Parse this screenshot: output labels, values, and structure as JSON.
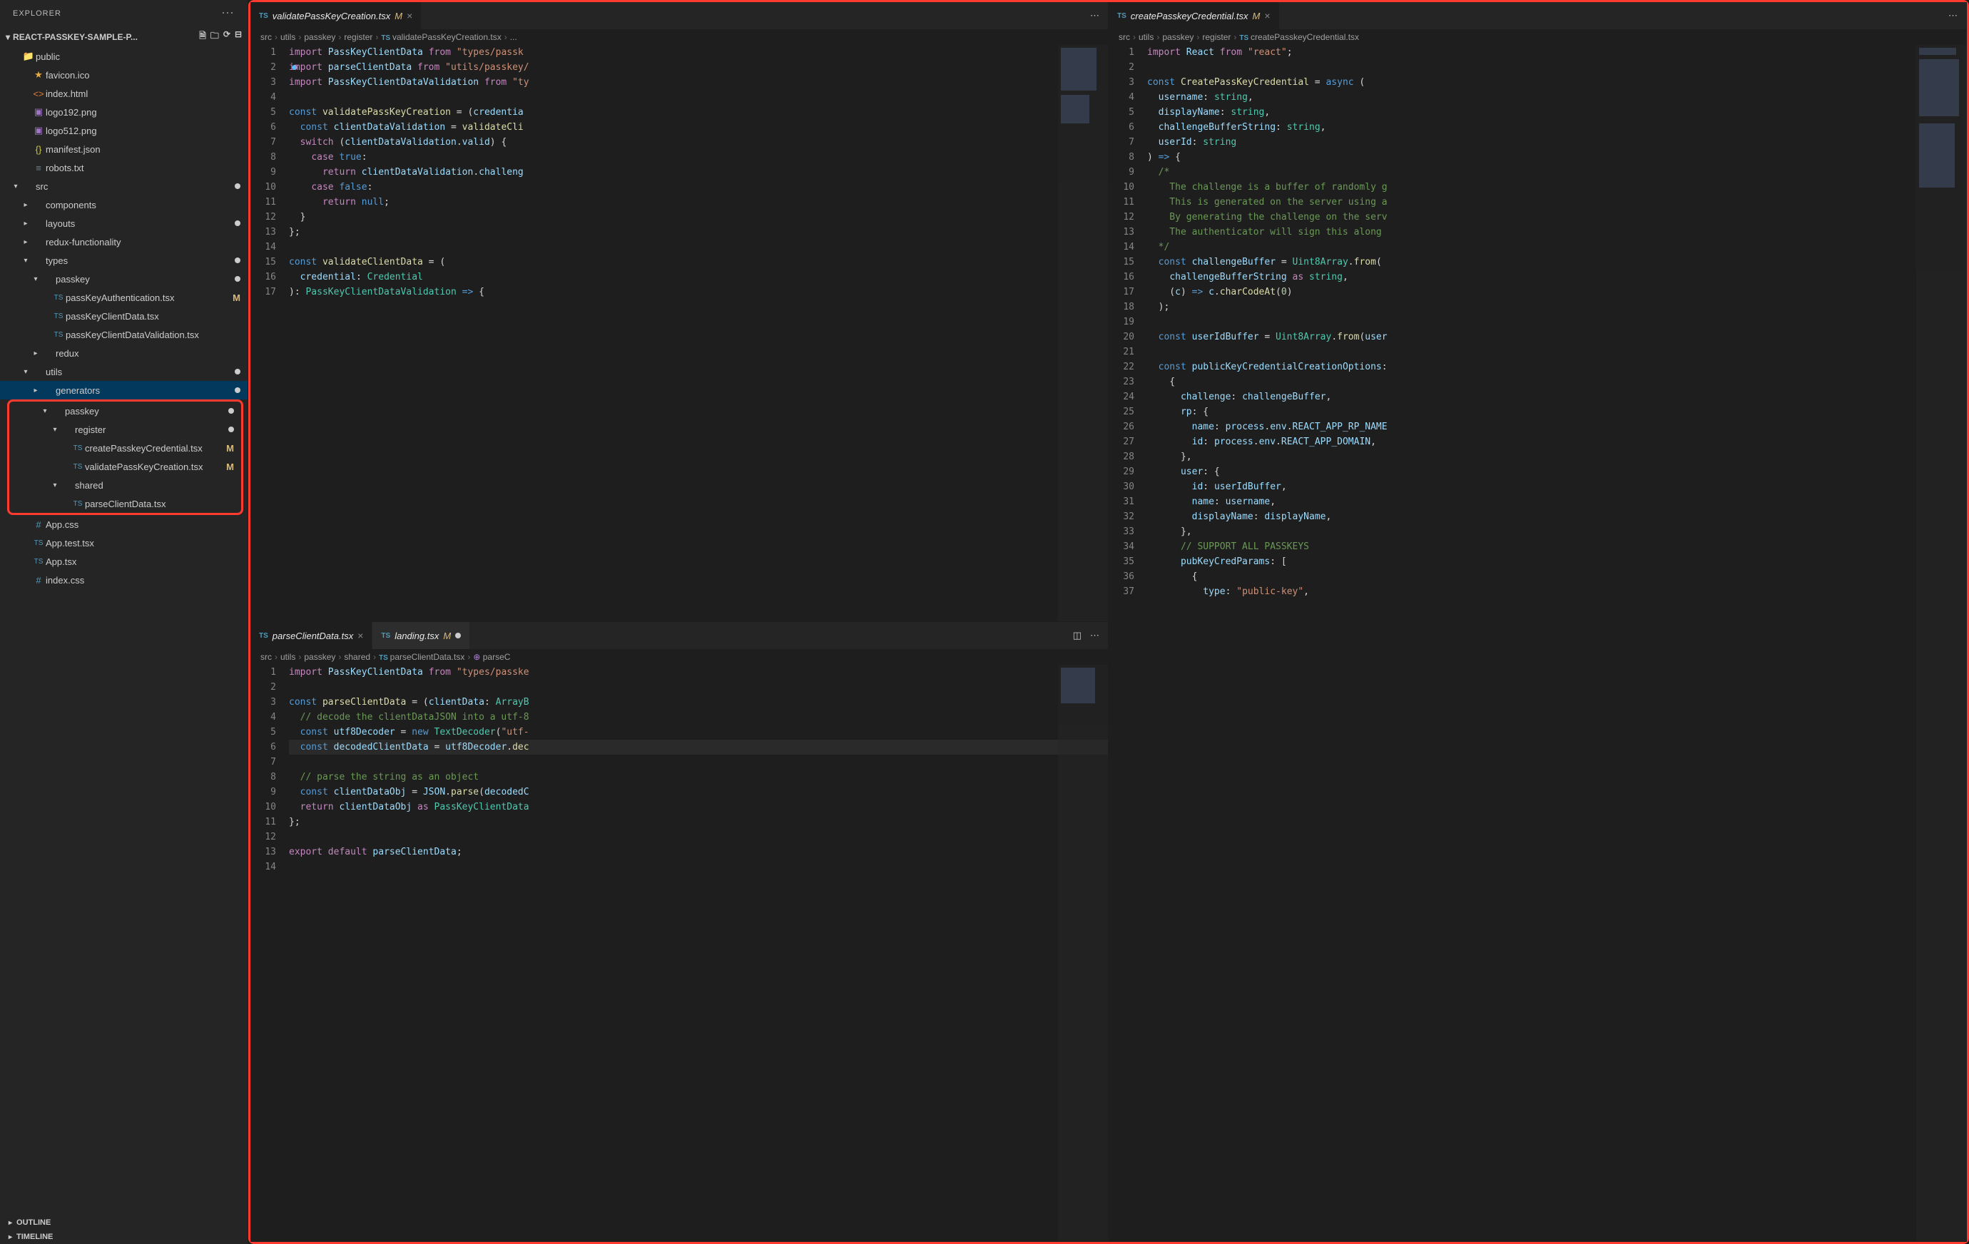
{
  "sidebar": {
    "title": "EXPLORER",
    "project": "REACT-PASSKEY-SAMPLE-P...",
    "outline": "OUTLINE",
    "timeline": "TIMELINE"
  },
  "tree": [
    {
      "depth": 1,
      "twisty": "",
      "icon": "📁",
      "label": "public",
      "color": "#c09553",
      "dot": false
    },
    {
      "depth": 2,
      "twisty": "",
      "icon": "★",
      "iconColor": "#e8ab3f",
      "label": "favicon.ico"
    },
    {
      "depth": 2,
      "twisty": "",
      "icon": "<>",
      "iconColor": "#e37933",
      "label": "index.html"
    },
    {
      "depth": 2,
      "twisty": "",
      "icon": "▣",
      "iconColor": "#a074c4",
      "label": "logo192.png"
    },
    {
      "depth": 2,
      "twisty": "",
      "icon": "▣",
      "iconColor": "#a074c4",
      "label": "logo512.png"
    },
    {
      "depth": 2,
      "twisty": "",
      "icon": "{}",
      "iconColor": "#cbcb41",
      "label": "manifest.json"
    },
    {
      "depth": 2,
      "twisty": "",
      "icon": "≡",
      "iconColor": "#6d8086",
      "label": "robots.txt"
    },
    {
      "depth": 1,
      "twisty": "▾",
      "icon": "",
      "label": "src",
      "dot": true
    },
    {
      "depth": 2,
      "twisty": "▸",
      "icon": "",
      "label": "components"
    },
    {
      "depth": 2,
      "twisty": "▸",
      "icon": "",
      "label": "layouts",
      "dot": true
    },
    {
      "depth": 2,
      "twisty": "▸",
      "icon": "",
      "label": "redux-functionality"
    },
    {
      "depth": 2,
      "twisty": "▾",
      "icon": "",
      "label": "types",
      "dot": true
    },
    {
      "depth": 3,
      "twisty": "▾",
      "icon": "",
      "label": "passkey",
      "dot": true
    },
    {
      "depth": 4,
      "twisty": "",
      "icon": "TS",
      "iconColor": "#519aba",
      "label": "passKeyAuthentication.tsx",
      "badge": "M"
    },
    {
      "depth": 4,
      "twisty": "",
      "icon": "TS",
      "iconColor": "#519aba",
      "label": "passKeyClientData.tsx"
    },
    {
      "depth": 4,
      "twisty": "",
      "icon": "TS",
      "iconColor": "#519aba",
      "label": "passKeyClientDataValidation.tsx"
    },
    {
      "depth": 3,
      "twisty": "▸",
      "icon": "",
      "label": "redux"
    },
    {
      "depth": 2,
      "twisty": "▾",
      "icon": "",
      "label": "utils",
      "dot": true
    },
    {
      "depth": 3,
      "twisty": "▸",
      "icon": "",
      "label": "generators",
      "dot": true,
      "selected": true
    },
    {
      "depth": 3,
      "twisty": "▾",
      "icon": "",
      "label": "passkey",
      "dot": true,
      "redstart": true
    },
    {
      "depth": 4,
      "twisty": "▾",
      "icon": "",
      "label": "register",
      "dot": true
    },
    {
      "depth": 5,
      "twisty": "",
      "icon": "TS",
      "iconColor": "#519aba",
      "label": "createPasskeyCredential.tsx",
      "badge": "M"
    },
    {
      "depth": 5,
      "twisty": "",
      "icon": "TS",
      "iconColor": "#519aba",
      "label": "validatePassKeyCreation.tsx",
      "badge": "M"
    },
    {
      "depth": 4,
      "twisty": "▾",
      "icon": "",
      "label": "shared"
    },
    {
      "depth": 5,
      "twisty": "",
      "icon": "TS",
      "iconColor": "#519aba",
      "label": "parseClientData.tsx",
      "redend": true
    },
    {
      "depth": 2,
      "twisty": "",
      "icon": "#",
      "iconColor": "#519aba",
      "label": "App.css"
    },
    {
      "depth": 2,
      "twisty": "",
      "icon": "TS",
      "iconColor": "#519aba",
      "label": "App.test.tsx"
    },
    {
      "depth": 2,
      "twisty": "",
      "icon": "TS",
      "iconColor": "#519aba",
      "label": "App.tsx"
    },
    {
      "depth": 2,
      "twisty": "",
      "icon": "#",
      "iconColor": "#519aba",
      "label": "index.css"
    }
  ],
  "tabs": {
    "p1": {
      "name": "validatePassKeyCreation.tsx",
      "mod": "M"
    },
    "p2a": {
      "name": "parseClientData.tsx"
    },
    "p2b": {
      "name": "landing.tsx",
      "mod": "M",
      "dirty": true
    },
    "p3": {
      "name": "createPasskeyCredential.tsx",
      "mod": "M"
    }
  },
  "crumbs": {
    "p1": [
      "src",
      "utils",
      "passkey",
      "register",
      "TS validatePassKeyCreation.tsx",
      "..."
    ],
    "p2": [
      "src",
      "utils",
      "passkey",
      "shared",
      "TS parseClientData.tsx",
      "[@] parseC"
    ],
    "p3": [
      "src",
      "utils",
      "passkey",
      "register",
      "TS createPasskeyCredential.tsx"
    ]
  },
  "code1": [
    {
      "n": 1,
      "h": "<span class='k-import'>import</span> <span class='k-var'>PassKeyClientData</span> <span class='k-import'>from</span> <span class='k-str'>\"types/passk</span>"
    },
    {
      "n": 2,
      "h": "<span class='k-import' style='background:radial-gradient(circle,#4fc1ff 30%,transparent 32%);'>im</span><span class='k-import'>port</span> <span class='k-var'>parseClientData</span> <span class='k-import'>from</span> <span class='k-str'>\"utils/passkey/</span>"
    },
    {
      "n": 3,
      "h": "<span class='k-import'>import</span> <span class='k-var'>PassKeyClientDataValidation</span> <span class='k-import'>from</span> <span class='k-str'>\"ty</span>"
    },
    {
      "n": 4,
      "h": ""
    },
    {
      "n": 5,
      "h": "<span class='k-kw'>const</span> <span class='k-fn'>validatePassKeyCreation</span> = (<span class='k-var'>credentia</span>"
    },
    {
      "n": 6,
      "h": "  <span class='k-kw'>const</span> <span class='k-var'>clientDataValidation</span> = <span class='k-fn'>validateCli</span>"
    },
    {
      "n": 7,
      "h": "  <span class='k-import'>switch</span> (<span class='k-var'>clientDataValidation</span>.<span class='k-var'>valid</span>) {"
    },
    {
      "n": 8,
      "h": "    <span class='k-import'>case</span> <span class='k-kw'>true</span>:"
    },
    {
      "n": 9,
      "h": "      <span class='k-import'>return</span> <span class='k-var'>clientDataValidation</span>.<span class='k-var'>challeng</span>"
    },
    {
      "n": 10,
      "h": "    <span class='k-import'>case</span> <span class='k-kw'>false</span>:"
    },
    {
      "n": 11,
      "h": "      <span class='k-import'>return</span> <span class='k-kw'>null</span>;"
    },
    {
      "n": 12,
      "h": "  }"
    },
    {
      "n": 13,
      "h": "};"
    },
    {
      "n": 14,
      "h": ""
    },
    {
      "n": 15,
      "h": "<span class='k-kw'>const</span> <span class='k-fn'>validateClientData</span> = ("
    },
    {
      "n": 16,
      "h": "  <span class='k-var'>credential</span>: <span class='k-type'>Credential</span>"
    },
    {
      "n": 17,
      "h": "): <span class='k-type'>PassKeyClientDataValidation</span> <span class='k-kw'>=&gt;</span> {"
    }
  ],
  "code2": [
    {
      "n": 1,
      "h": "<span class='k-import'>import</span> <span class='k-var'>PassKeyClientData</span> <span class='k-import'>from</span> <span class='k-str'>\"types/passke</span>"
    },
    {
      "n": 2,
      "h": ""
    },
    {
      "n": 3,
      "h": "<span class='k-kw'>const</span> <span class='k-fn'>parseClientData</span> = (<span class='k-var'>clientData</span>: <span class='k-type'>ArrayB</span>"
    },
    {
      "n": 4,
      "h": "  <span class='k-com'>// decode the clientDataJSON into a utf-8</span>"
    },
    {
      "n": 5,
      "h": "  <span class='k-kw'>const</span> <span class='k-var'>utf8Decoder</span> = <span class='k-kw'>new</span> <span class='k-type'>TextDecoder</span>(<span class='k-str'>\"utf-</span>"
    },
    {
      "n": 6,
      "h": "  <span class='k-kw'>const</span> <span class='k-var'>decodedClientData</span> = <span class='k-var'>utf8Decoder</span>.<span class='k-fn'>dec</span>",
      "hl": true
    },
    {
      "n": 7,
      "h": ""
    },
    {
      "n": 8,
      "h": "  <span class='k-com'>// parse the string as an object</span>"
    },
    {
      "n": 9,
      "h": "  <span class='k-kw'>const</span> <span class='k-var'>clientDataObj</span> = <span class='k-var'>JSON</span>.<span class='k-fn'>parse</span>(<span class='k-var'>decodedC</span>"
    },
    {
      "n": 10,
      "h": "  <span class='k-import'>return</span> <span class='k-var'>clientDataObj</span> <span class='k-import'>as</span> <span class='k-type'>PassKeyClientData</span>"
    },
    {
      "n": 11,
      "h": "};"
    },
    {
      "n": 12,
      "h": ""
    },
    {
      "n": 13,
      "h": "<span class='k-import'>export</span> <span class='k-import'>default</span> <span class='k-var'>parseClientData</span>;"
    },
    {
      "n": 14,
      "h": ""
    }
  ],
  "code3": [
    {
      "n": 1,
      "h": "<span class='k-import'>import</span> <span class='k-var'>React</span> <span class='k-import'>from</span> <span class='k-str'>\"react\"</span>;"
    },
    {
      "n": 2,
      "h": ""
    },
    {
      "n": 3,
      "h": "<span class='k-kw'>const</span> <span class='k-fn'>CreatePassKeyCredential</span> = <span class='k-kw'>async</span> ("
    },
    {
      "n": 4,
      "h": "  <span class='k-var'>username</span>: <span class='k-type'>string</span>,"
    },
    {
      "n": 5,
      "h": "  <span class='k-var'>displayName</span>: <span class='k-type'>string</span>,"
    },
    {
      "n": 6,
      "h": "  <span class='k-var'>challengeBufferString</span>: <span class='k-type'>string</span>,"
    },
    {
      "n": 7,
      "h": "  <span class='k-var'>userId</span>: <span class='k-type'>string</span>"
    },
    {
      "n": 8,
      "h": ") <span class='k-kw'>=&gt;</span> {"
    },
    {
      "n": 9,
      "h": "  <span class='k-com'>/*</span>"
    },
    {
      "n": 10,
      "h": "<span class='k-com'>    The challenge is a buffer of randomly g</span>"
    },
    {
      "n": 11,
      "h": "<span class='k-com'>    This is generated on the server using a</span>"
    },
    {
      "n": 12,
      "h": "<span class='k-com'>    By generating the challenge on the serv</span>"
    },
    {
      "n": 13,
      "h": "<span class='k-com'>    The authenticator will sign this along </span>"
    },
    {
      "n": 14,
      "h": "<span class='k-com'>  */</span>"
    },
    {
      "n": 15,
      "h": "  <span class='k-kw'>const</span> <span class='k-var'>challengeBuffer</span> = <span class='k-type'>Uint8Array</span>.<span class='k-fn'>from</span>("
    },
    {
      "n": 16,
      "h": "    <span class='k-var'>challengeBufferString</span> <span class='k-import'>as</span> <span class='k-type'>string</span>,"
    },
    {
      "n": 17,
      "h": "    (<span class='k-var'>c</span>) <span class='k-kw'>=&gt;</span> <span class='k-var'>c</span>.<span class='k-fn'>charCodeAt</span>(<span class='k-num'>0</span>)"
    },
    {
      "n": 18,
      "h": "  );"
    },
    {
      "n": 19,
      "h": ""
    },
    {
      "n": 20,
      "h": "  <span class='k-kw'>const</span> <span class='k-var'>userIdBuffer</span> = <span class='k-type'>Uint8Array</span>.<span class='k-fn'>from</span>(<span class='k-var'>user</span>"
    },
    {
      "n": 21,
      "h": ""
    },
    {
      "n": 22,
      "h": "  <span class='k-kw'>const</span> <span class='k-var'>publicKeyCredentialCreationOptions</span>:"
    },
    {
      "n": 23,
      "h": "    {"
    },
    {
      "n": 24,
      "h": "      <span class='k-var'>challenge</span>: <span class='k-var'>challengeBuffer</span>,"
    },
    {
      "n": 25,
      "h": "      <span class='k-var'>rp</span>: {"
    },
    {
      "n": 26,
      "h": "        <span class='k-var'>name</span>: <span class='k-var'>process</span>.<span class='k-var'>env</span>.<span class='k-var'>REACT_APP_RP_NAME</span>"
    },
    {
      "n": 27,
      "h": "        <span class='k-var'>id</span>: <span class='k-var'>process</span>.<span class='k-var'>env</span>.<span class='k-var'>REACT_APP_DOMAIN</span>,"
    },
    {
      "n": 28,
      "h": "      },"
    },
    {
      "n": 29,
      "h": "      <span class='k-var'>user</span>: {"
    },
    {
      "n": 30,
      "h": "        <span class='k-var'>id</span>: <span class='k-var'>userIdBuffer</span>,"
    },
    {
      "n": 31,
      "h": "        <span class='k-var'>name</span>: <span class='k-var'>username</span>,"
    },
    {
      "n": 32,
      "h": "        <span class='k-var'>displayName</span>: <span class='k-var'>displayName</span>,"
    },
    {
      "n": 33,
      "h": "      },"
    },
    {
      "n": 34,
      "h": "      <span class='k-com'>// SUPPORT ALL PASSKEYS</span>"
    },
    {
      "n": 35,
      "h": "      <span class='k-var'>pubKeyCredParams</span>: ["
    },
    {
      "n": 36,
      "h": "        {"
    },
    {
      "n": 37,
      "h": "          <span class='k-var'>type</span>: <span class='k-str'>\"public-key\"</span>,"
    }
  ]
}
